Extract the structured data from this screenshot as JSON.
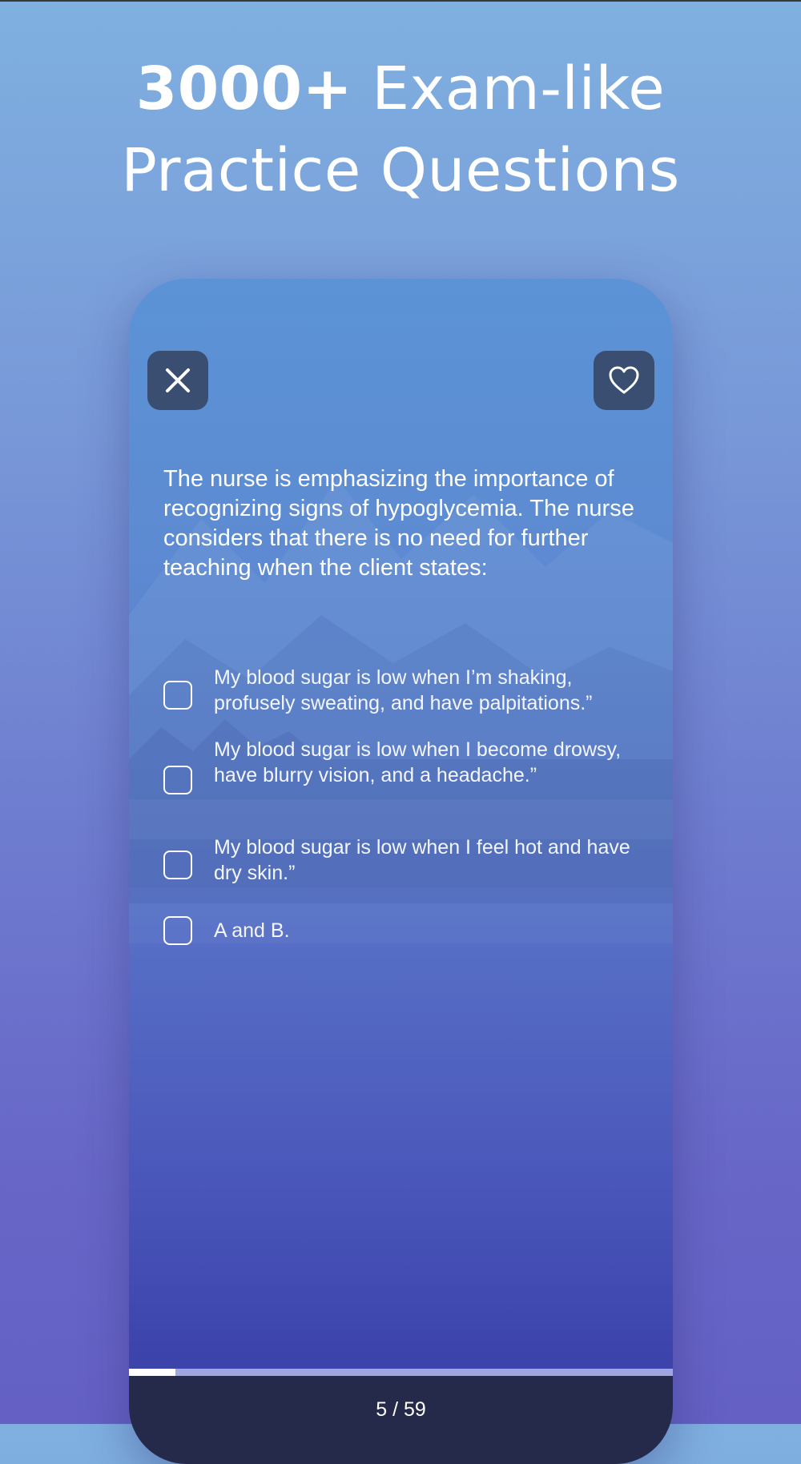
{
  "headline": {
    "line1_bold": "3000+",
    "line1_rest": " Exam-like",
    "line2": "Practice Questions"
  },
  "toolbar": {
    "close_icon": "close-icon",
    "favorite_icon": "heart-icon"
  },
  "question": {
    "text": "The nurse is emphasizing the importance of recognizing signs of hypoglycemia. The nurse considers that there is no need for further teaching when the client states:"
  },
  "options": [
    {
      "label": "My blood sugar is low when I’m shaking, profusely sweating, and have palpitations.”",
      "checked": false
    },
    {
      "label": "My blood sugar is low when I become drowsy, have blurry vision, and a headache.”",
      "checked": false
    },
    {
      "label": "My blood sugar is low when I feel hot and have dry skin.”",
      "checked": false
    },
    {
      "label": "A and B.",
      "checked": false
    }
  ],
  "progress": {
    "current": 5,
    "total": 59,
    "label": "5 / 59"
  },
  "colors": {
    "icon_button_bg": "#3a4e72",
    "footer_bg": "#262a4a",
    "progress_fill": "#ffffff",
    "progress_track": "#9fa6e0"
  }
}
